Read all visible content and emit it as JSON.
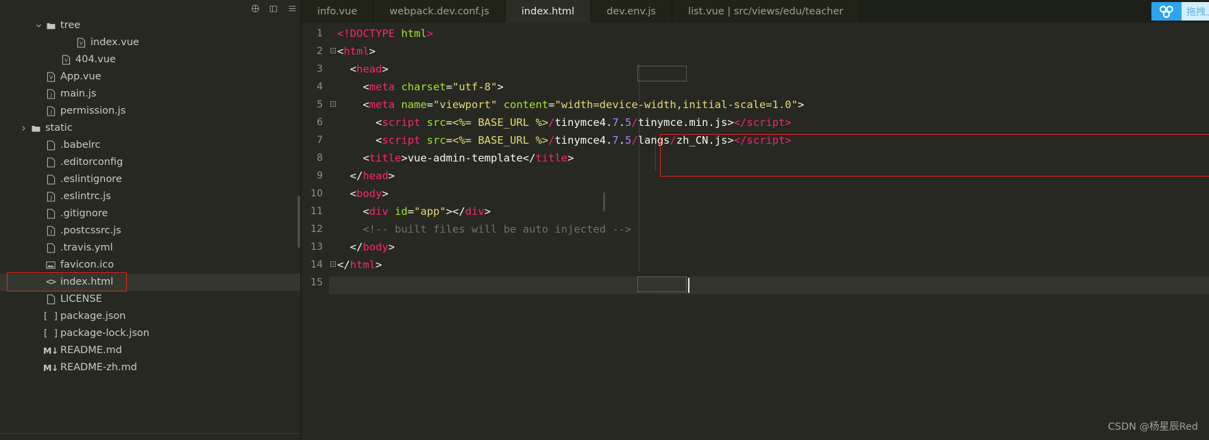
{
  "window": {
    "theme_bg": "#262821",
    "accent_red": "#e8231f",
    "accent_blue": "#2ca4ef"
  },
  "sidebar": {
    "toolbar": [
      {
        "name": "collapse-all-icon",
        "label": "collapse-all"
      },
      {
        "name": "split-editor-icon",
        "label": "split-editor"
      },
      {
        "name": "more-actions-icon",
        "label": "more-actions"
      }
    ],
    "tree": [
      {
        "label": "tree",
        "icon": "folder-open-icon",
        "indent": 2,
        "chevron": "down",
        "selected": false
      },
      {
        "label": "index.vue",
        "icon": "vue-file-icon",
        "indent": 4,
        "chevron": "none",
        "selected": false
      },
      {
        "label": "404.vue",
        "icon": "vue-file-icon",
        "indent": 3,
        "chevron": "none",
        "selected": false
      },
      {
        "label": "App.vue",
        "icon": "vue-file-icon",
        "indent": 2,
        "chevron": "none",
        "selected": false
      },
      {
        "label": "main.js",
        "icon": "js-file-icon",
        "indent": 2,
        "chevron": "none",
        "selected": false
      },
      {
        "label": "permission.js",
        "icon": "js-file-icon",
        "indent": 2,
        "chevron": "none",
        "selected": false
      },
      {
        "label": "static",
        "icon": "folder-icon",
        "indent": 1,
        "chevron": "right",
        "selected": false
      },
      {
        "label": ".babelrc",
        "icon": "file-icon",
        "indent": 2,
        "chevron": "none",
        "selected": false
      },
      {
        "label": ".editorconfig",
        "icon": "file-icon",
        "indent": 2,
        "chevron": "none",
        "selected": false
      },
      {
        "label": ".eslintignore",
        "icon": "file-icon",
        "indent": 2,
        "chevron": "none",
        "selected": false
      },
      {
        "label": ".eslintrc.js",
        "icon": "js-file-icon",
        "indent": 2,
        "chevron": "none",
        "selected": false
      },
      {
        "label": ".gitignore",
        "icon": "file-icon",
        "indent": 2,
        "chevron": "none",
        "selected": false
      },
      {
        "label": ".postcssrc.js",
        "icon": "js-file-icon",
        "indent": 2,
        "chevron": "none",
        "selected": false
      },
      {
        "label": ".travis.yml",
        "icon": "file-icon",
        "indent": 2,
        "chevron": "none",
        "selected": false
      },
      {
        "label": "favicon.ico",
        "icon": "image-file-icon",
        "indent": 2,
        "chevron": "none",
        "selected": false
      },
      {
        "label": "index.html",
        "icon": "html-file-icon",
        "indent": 2,
        "chevron": "none",
        "selected": true
      },
      {
        "label": "LICENSE",
        "icon": "file-icon",
        "indent": 2,
        "chevron": "none",
        "selected": false
      },
      {
        "label": "package.json",
        "icon": "json-file-icon",
        "indent": 2,
        "chevron": "none",
        "selected": false
      },
      {
        "label": "package-lock.json",
        "icon": "json-file-icon",
        "indent": 2,
        "chevron": "none",
        "selected": false
      },
      {
        "label": "README.md",
        "icon": "markdown-file-icon",
        "indent": 2,
        "chevron": "none",
        "selected": false
      },
      {
        "label": "README-zh.md",
        "icon": "markdown-file-icon",
        "indent": 2,
        "chevron": "none",
        "selected": false
      }
    ]
  },
  "tabs": [
    {
      "label": "info.vue",
      "active": false
    },
    {
      "label": "webpack.dev.conf.js",
      "active": false
    },
    {
      "label": "index.html",
      "active": true
    },
    {
      "label": "dev.env.js",
      "active": false
    },
    {
      "label": "list.vue | src/views/edu/teacher",
      "active": false
    }
  ],
  "drag_upload": {
    "icon": "baidu-netdisk-icon",
    "label": "拖拽上传"
  },
  "editor": {
    "language": "html",
    "current_line": 14,
    "cursor_column": 8,
    "lines": [
      {
        "num": 1,
        "fold": "",
        "tokens": [
          {
            "t": "<!DOCTYPE",
            "c": "tag"
          },
          {
            "t": " ",
            "c": "plain"
          },
          {
            "t": "html",
            "c": "attr"
          },
          {
            "t": ">",
            "c": "tag"
          }
        ]
      },
      {
        "num": 2,
        "fold": "-",
        "tokens": [
          {
            "t": "<",
            "c": "punct"
          },
          {
            "t": "html",
            "c": "tag"
          },
          {
            "t": ">",
            "c": "punct"
          }
        ]
      },
      {
        "num": 3,
        "fold": "",
        "tokens": [
          {
            "t": "  <",
            "c": "punct"
          },
          {
            "t": "head",
            "c": "tag"
          },
          {
            "t": ">",
            "c": "punct"
          }
        ]
      },
      {
        "num": 4,
        "fold": "",
        "tokens": [
          {
            "t": "    <",
            "c": "punct"
          },
          {
            "t": "meta",
            "c": "tag"
          },
          {
            "t": " ",
            "c": "plain"
          },
          {
            "t": "charset",
            "c": "attr"
          },
          {
            "t": "=",
            "c": "plain"
          },
          {
            "t": "\"utf-8\"",
            "c": "str"
          },
          {
            "t": ">",
            "c": "punct"
          }
        ]
      },
      {
        "num": 5,
        "fold": "-",
        "tokens": [
          {
            "t": "    <",
            "c": "punct"
          },
          {
            "t": "meta",
            "c": "tag"
          },
          {
            "t": " ",
            "c": "plain"
          },
          {
            "t": "name",
            "c": "attr"
          },
          {
            "t": "=",
            "c": "plain"
          },
          {
            "t": "\"viewport\"",
            "c": "str"
          },
          {
            "t": " ",
            "c": "plain"
          },
          {
            "t": "content",
            "c": "attr"
          },
          {
            "t": "=",
            "c": "plain"
          },
          {
            "t": "\"width=device-width,initial-scale=1.0\"",
            "c": "str"
          },
          {
            "t": ">",
            "c": "punct"
          }
        ]
      },
      {
        "num": 6,
        "fold": "",
        "tokens": [
          {
            "t": "      <",
            "c": "punct"
          },
          {
            "t": "script",
            "c": "tag"
          },
          {
            "t": " ",
            "c": "plain"
          },
          {
            "t": "src",
            "c": "attr"
          },
          {
            "t": "=",
            "c": "plain"
          },
          {
            "t": "<%= BASE_URL %>",
            "c": "str"
          },
          {
            "t": "/",
            "c": "tag"
          },
          {
            "t": "tinymce4",
            "c": "plain"
          },
          {
            "t": ".",
            "c": "plain"
          },
          {
            "t": "7",
            "c": "num"
          },
          {
            "t": ".",
            "c": "plain"
          },
          {
            "t": "5",
            "c": "num"
          },
          {
            "t": "/",
            "c": "tag"
          },
          {
            "t": "tinymce.min.js>",
            "c": "plain"
          },
          {
            "t": "</",
            "c": "tag"
          },
          {
            "t": "script",
            "c": "tag"
          },
          {
            "t": ">",
            "c": "tag"
          }
        ]
      },
      {
        "num": 7,
        "fold": "",
        "tokens": [
          {
            "t": "      <",
            "c": "punct"
          },
          {
            "t": "script",
            "c": "tag"
          },
          {
            "t": " ",
            "c": "plain"
          },
          {
            "t": "src",
            "c": "attr"
          },
          {
            "t": "=",
            "c": "plain"
          },
          {
            "t": "<%= BASE_URL %>",
            "c": "str"
          },
          {
            "t": "/",
            "c": "tag"
          },
          {
            "t": "tinymce4",
            "c": "plain"
          },
          {
            "t": ".",
            "c": "plain"
          },
          {
            "t": "7",
            "c": "num"
          },
          {
            "t": ".",
            "c": "plain"
          },
          {
            "t": "5",
            "c": "num"
          },
          {
            "t": "/",
            "c": "tag"
          },
          {
            "t": "langs",
            "c": "plain"
          },
          {
            "t": "/",
            "c": "tag"
          },
          {
            "t": "zh_CN.js>",
            "c": "plain"
          },
          {
            "t": "</",
            "c": "tag"
          },
          {
            "t": "script",
            "c": "tag"
          },
          {
            "t": ">",
            "c": "tag"
          }
        ]
      },
      {
        "num": 8,
        "fold": "",
        "tokens": [
          {
            "t": "    <",
            "c": "punct"
          },
          {
            "t": "title",
            "c": "tag"
          },
          {
            "t": ">",
            "c": "punct"
          },
          {
            "t": "vue-admin-template",
            "c": "plain"
          },
          {
            "t": "</",
            "c": "punct"
          },
          {
            "t": "title",
            "c": "tag"
          },
          {
            "t": ">",
            "c": "punct"
          }
        ]
      },
      {
        "num": 9,
        "fold": "",
        "tokens": [
          {
            "t": "  </",
            "c": "punct"
          },
          {
            "t": "head",
            "c": "tag"
          },
          {
            "t": ">",
            "c": "punct"
          }
        ]
      },
      {
        "num": 10,
        "fold": "",
        "tokens": [
          {
            "t": "  <",
            "c": "punct"
          },
          {
            "t": "body",
            "c": "tag"
          },
          {
            "t": ">",
            "c": "punct"
          }
        ]
      },
      {
        "num": 11,
        "fold": "",
        "tokens": [
          {
            "t": "    <",
            "c": "punct"
          },
          {
            "t": "div",
            "c": "tag"
          },
          {
            "t": " ",
            "c": "plain"
          },
          {
            "t": "id",
            "c": "attr"
          },
          {
            "t": "=",
            "c": "plain"
          },
          {
            "t": "\"app\"",
            "c": "str"
          },
          {
            "t": ">",
            "c": "punct"
          },
          {
            "t": "</",
            "c": "punct"
          },
          {
            "t": "div",
            "c": "tag"
          },
          {
            "t": ">",
            "c": "punct"
          }
        ]
      },
      {
        "num": 12,
        "fold": "",
        "tokens": [
          {
            "t": "    <!-- built files will be auto injected -->",
            "c": "cmt"
          }
        ]
      },
      {
        "num": 13,
        "fold": "",
        "tokens": [
          {
            "t": "  </",
            "c": "punct"
          },
          {
            "t": "body",
            "c": "tag"
          },
          {
            "t": ">",
            "c": "punct"
          }
        ]
      },
      {
        "num": 14,
        "fold": "-",
        "tokens": [
          {
            "t": "</",
            "c": "punct"
          },
          {
            "t": "html",
            "c": "tag"
          },
          {
            "t": ">",
            "c": "punct"
          }
        ]
      },
      {
        "num": 15,
        "fold": "",
        "tokens": []
      }
    ]
  },
  "watermark": "CSDN @杨星辰Red"
}
